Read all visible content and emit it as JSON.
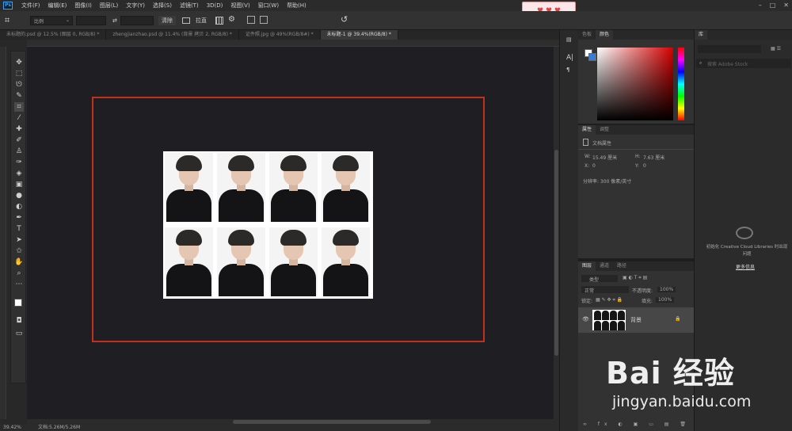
{
  "menubar": {
    "logo": "Ps",
    "items": [
      "文件(F)",
      "编辑(E)",
      "图像(I)",
      "图层(L)",
      "文字(Y)",
      "选择(S)",
      "滤镜(T)",
      "3D(D)",
      "视图(V)",
      "窗口(W)",
      "帮助(H)"
    ]
  },
  "options_bar": {
    "ratio_select": "比例",
    "swap_icon": "⇄",
    "clear_button": "清除",
    "straighten_button": "拉直"
  },
  "tabs": [
    {
      "label": "未标题的.psd @ 12.5% (图层 0, RGB/8) *",
      "active": false
    },
    {
      "label": "zhengjianzhao.psd @ 11.4% (背景 拷贝 2, RGB/8) *",
      "active": false
    },
    {
      "label": "证件照.jpg @ 49%(RGB/8#) *",
      "active": false
    },
    {
      "label": "未标题-1 @ 39.4%(RGB/8) *",
      "active": true
    }
  ],
  "status": {
    "zoom": "39.42%",
    "doc_size": "文档:5.26M/5.26M"
  },
  "color_panel": {
    "tabs": [
      "色板",
      "颜色"
    ],
    "active_tab": "颜色"
  },
  "props_panel": {
    "tabs": [
      "属性",
      "调整"
    ],
    "section_title": "文档属性",
    "w_label": "W:",
    "w_value": "15.49 厘米",
    "h_label": "H:",
    "h_value": "7.63 厘米",
    "x_label": "X:",
    "x_value": "0",
    "y_label": "Y:",
    "y_value": "0",
    "resolution": "分辨率: 300 像素/英寸"
  },
  "layers_panel": {
    "tabs": [
      "图层",
      "通道",
      "路径"
    ],
    "kind_filter": "类型",
    "blend_mode": "正常",
    "opacity_label": "不透明度:",
    "opacity_value": "100%",
    "lock_label": "锁定:",
    "fill_label": "填充:",
    "fill_value": "100%",
    "layer_name": "背景"
  },
  "library_panel": {
    "tab": "库",
    "search_placeholder": "搜索 Adobe Stock",
    "message": "初始化 Creative Cloud Libraries 时出现问题",
    "more_link": "更多信息"
  },
  "watermark": {
    "brand": "Bai 经验",
    "url": "jingyan.baidu.com"
  },
  "photo_grid": {
    "rows": 2,
    "cols": 4
  },
  "colors": {
    "frame": "#c43020",
    "accent": "#31a8ff"
  }
}
